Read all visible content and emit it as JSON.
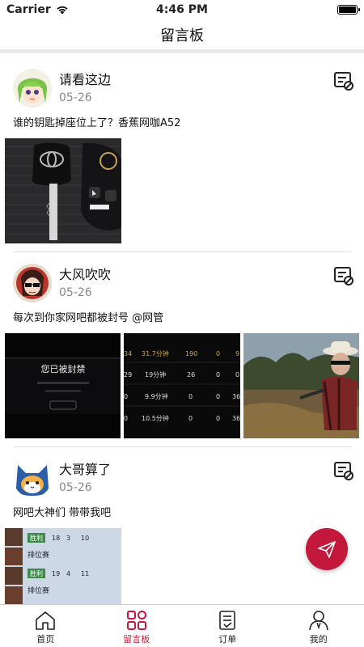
{
  "status_bar": {
    "carrier": "Carrier",
    "time": "4:46 PM",
    "battery_level": 1.0
  },
  "nav": {
    "title": "留言板"
  },
  "posts": [
    {
      "user": "请看这边",
      "date": "05-26",
      "text": "谁的钥匙掉座位上了？香蕉网咖A52",
      "images": [
        "car-keys-photo"
      ]
    },
    {
      "user": "大风吹吹",
      "date": "05-26",
      "text": "每次到你家网吧都被封号 @网管",
      "images": [
        "banned-screen-photo",
        "game-stats-photo",
        "game-character-photo"
      ],
      "image_texts": {
        "banned": "您已被封禁",
        "stats": [
          "34",
          "31.7分钟",
          "190",
          "0",
          "9",
          "29",
          "19分钟",
          "26",
          "0",
          "0",
          "0",
          "9.9分钟",
          "0",
          "0",
          "36",
          "0",
          "10.5分钟",
          "0",
          "0",
          "36"
        ]
      }
    },
    {
      "user": "大哥算了",
      "date": "05-26",
      "text": "网吧大神们 带带我吧",
      "images": [
        "game-ranking-photo"
      ],
      "image_texts": {
        "badges": [
          "胜利",
          "胜利"
        ],
        "ranks": [
          "排位赛",
          "排位赛"
        ],
        "stats1": [
          "18",
          "3",
          "10"
        ],
        "stats2": [
          "19",
          "4",
          "11"
        ]
      }
    }
  ],
  "tabs": [
    {
      "label": "首页",
      "icon": "home-icon",
      "active": false
    },
    {
      "label": "留言板",
      "icon": "board-icon",
      "active": true
    },
    {
      "label": "订单",
      "icon": "order-icon",
      "active": false
    },
    {
      "label": "我的",
      "icon": "profile-icon",
      "active": false
    }
  ],
  "colors": {
    "accent": "#c3183b",
    "divider": "#e7e7ee"
  }
}
